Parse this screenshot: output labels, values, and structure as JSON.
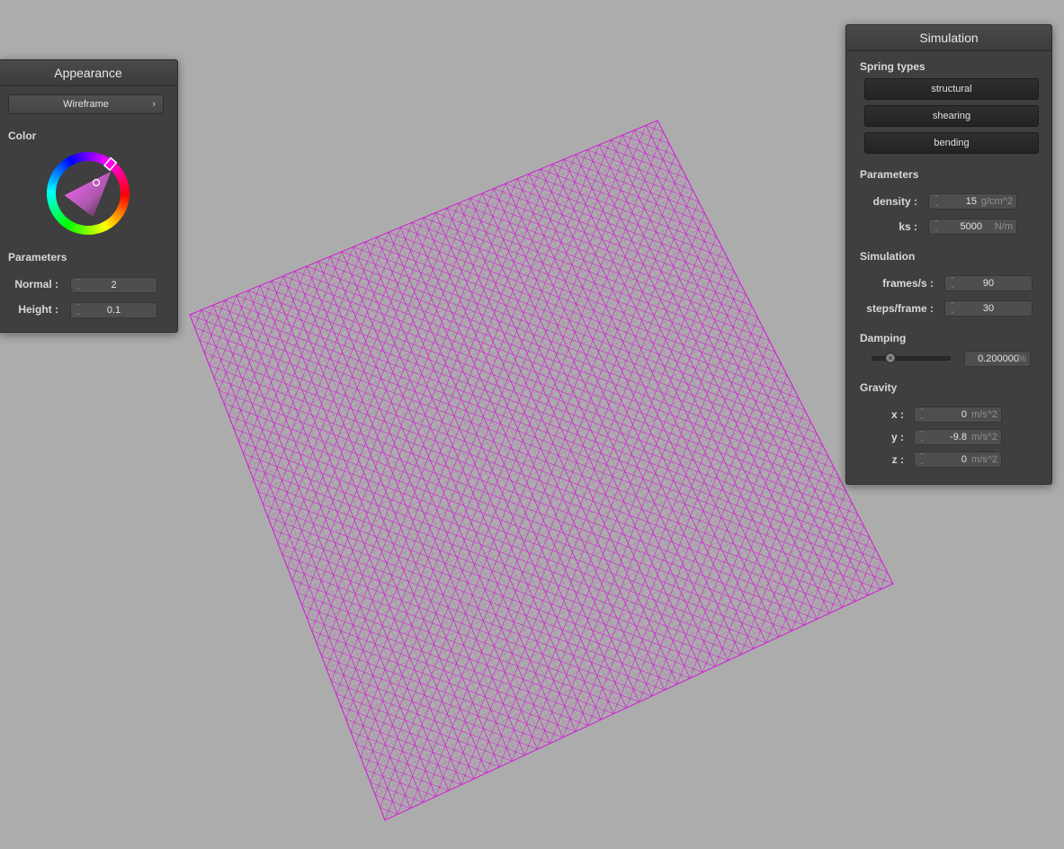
{
  "appearance": {
    "title": "Appearance",
    "mode_label": "Wireframe",
    "color_label": "Color",
    "parameters_label": "Parameters",
    "normal_label": "Normal :",
    "normal_value": "2",
    "height_label": "Height :",
    "height_value": "0.1"
  },
  "simulation": {
    "title": "Simulation",
    "spring_types_label": "Spring types",
    "structural_label": "structural",
    "shearing_label": "shearing",
    "bending_label": "bending",
    "parameters_label": "Parameters",
    "density_label": "density :",
    "density_value": "15",
    "density_unit": "g/cm^2",
    "ks_label": "ks :",
    "ks_value": "5000",
    "ks_unit": "N/m",
    "simulation_label": "Simulation",
    "fps_label": "frames/s :",
    "fps_value": "90",
    "steps_label": "steps/frame :",
    "steps_value": "30",
    "damping_label": "Damping",
    "damping_value": "0.200000",
    "damping_unit": "%",
    "damping_slider_fraction": 0.2,
    "gravity_label": "Gravity",
    "gx_label": "x :",
    "gx_value": "0",
    "gy_label": "y :",
    "gy_value": "-9.8",
    "gz_label": "z :",
    "gz_value": "0",
    "gravity_unit": "m/s^2"
  },
  "colors": {
    "background": "#acacac",
    "wire": "#d41ad8",
    "panel": "#3f3f3f"
  }
}
